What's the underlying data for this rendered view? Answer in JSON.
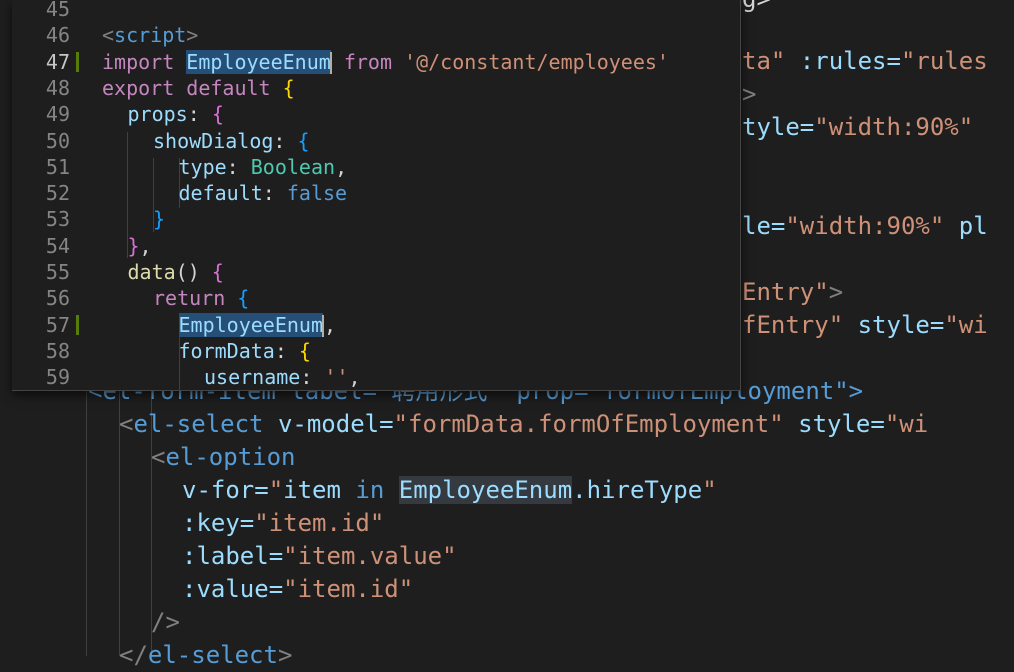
{
  "background_code": [
    {
      "segs": [
        {
          "t": "g>",
          "c": "#d4d4d4"
        }
      ]
    },
    {
      "segs": [
        {
          "t": "ta\"",
          "c": "#ce9178"
        },
        {
          "t": " :rules=",
          "c": "#9cdcfe"
        },
        {
          "t": "\"rules",
          "c": "#ce9178"
        }
      ]
    },
    {
      "segs": [
        {
          "t": ">",
          "c": "#808080"
        }
      ]
    },
    {
      "segs": [
        {
          "t": "tyle=",
          "c": "#9cdcfe"
        },
        {
          "t": "\"width:90%\"",
          "c": "#ce9178"
        }
      ]
    },
    {
      "segs": []
    },
    {
      "segs": [
        {
          "t": "le=",
          "c": "#9cdcfe"
        },
        {
          "t": "\"width:90%\"",
          "c": "#ce9178"
        },
        {
          "t": " pl",
          "c": "#9cdcfe"
        }
      ]
    },
    {
      "segs": []
    },
    {
      "segs": [
        {
          "t": "Entry\"",
          "c": "#ce9178"
        },
        {
          "t": ">",
          "c": "#808080"
        }
      ]
    },
    {
      "segs": [
        {
          "t": "fEntry\"",
          "c": "#ce9178"
        },
        {
          "t": " style=",
          "c": "#9cdcfe"
        },
        {
          "t": "\"wi",
          "c": "#ce9178"
        }
      ]
    },
    {
      "segs": [
        {
          "t": "<el-form-item label=\"聘用形式\" prop=\"formOfEmployment\">",
          "c": "#569cd6"
        }
      ]
    },
    {
      "segs": [
        {
          "t": "<",
          "c": "#808080"
        },
        {
          "t": "el-select",
          "c": "#569cd6"
        },
        {
          "t": " v-model=",
          "c": "#9cdcfe"
        },
        {
          "t": "\"formData.formOfEmployment\"",
          "c": "#ce9178"
        },
        {
          "t": " style=",
          "c": "#9cdcfe"
        },
        {
          "t": "\"wi",
          "c": "#ce9178"
        }
      ]
    },
    {
      "segs": [
        {
          "t": "<",
          "c": "#808080"
        },
        {
          "t": "el-option",
          "c": "#569cd6"
        }
      ]
    },
    {
      "segs": [
        {
          "t": "v-for=",
          "c": "#9cdcfe"
        },
        {
          "t": "\"",
          "c": "#ce9178"
        },
        {
          "t": "item",
          "c": "#9cdcfe"
        },
        {
          "t": " in ",
          "c": "#569cd6"
        },
        {
          "t": "EmployeeEnum",
          "c": "#9cdcfe",
          "hl": true
        },
        {
          "t": ".hireType",
          "c": "#9cdcfe"
        },
        {
          "t": "\"",
          "c": "#ce9178"
        }
      ]
    },
    {
      "segs": [
        {
          "t": ":key=",
          "c": "#9cdcfe"
        },
        {
          "t": "\"item.id\"",
          "c": "#ce9178"
        }
      ]
    },
    {
      "segs": [
        {
          "t": ":label=",
          "c": "#9cdcfe"
        },
        {
          "t": "\"item.value\"",
          "c": "#ce9178"
        }
      ]
    },
    {
      "segs": [
        {
          "t": ":value=",
          "c": "#9cdcfe"
        },
        {
          "t": "\"item.id\"",
          "c": "#ce9178"
        }
      ]
    },
    {
      "segs": [
        {
          "t": "/>",
          "c": "#808080"
        }
      ]
    },
    {
      "segs": [
        {
          "t": "</",
          "c": "#808080"
        },
        {
          "t": "el-select",
          "c": "#569cd6"
        },
        {
          "t": ">",
          "c": "#808080"
        }
      ]
    }
  ],
  "peek": {
    "line_numbers": [
      "45",
      "46",
      "47",
      "48",
      "49",
      "50",
      "51",
      "52",
      "53",
      "54",
      "55",
      "56",
      "57",
      "58",
      "59"
    ],
    "active_line": "47",
    "modified_lines": [
      "47",
      "57"
    ],
    "lines": [
      {
        "segs": []
      },
      {
        "segs": [
          {
            "t": "<",
            "c": "tagp"
          },
          {
            "t": "script",
            "c": "tag"
          },
          {
            "t": ">",
            "c": "tagp"
          }
        ]
      },
      {
        "segs": [
          {
            "t": "import ",
            "c": "kw"
          },
          {
            "t": "EmployeeEnum",
            "c": "var",
            "hl": true,
            "caret": true
          },
          {
            "t": " from ",
            "c": "kw"
          },
          {
            "t": "'@/constant/employees'",
            "c": "str"
          }
        ]
      },
      {
        "segs": [
          {
            "t": "export ",
            "c": "kw"
          },
          {
            "t": "default ",
            "c": "kw"
          },
          {
            "t": "{",
            "c": "br1"
          }
        ]
      },
      {
        "segs": [
          {
            "t": "props",
            "c": "var"
          },
          {
            "t": ": ",
            "c": "plain"
          },
          {
            "t": "{",
            "c": "br2"
          }
        ]
      },
      {
        "segs": [
          {
            "t": "showDialog",
            "c": "var"
          },
          {
            "t": ": ",
            "c": "plain"
          },
          {
            "t": "{",
            "c": "br3"
          }
        ]
      },
      {
        "segs": [
          {
            "t": "type",
            "c": "var"
          },
          {
            "t": ": ",
            "c": "plain"
          },
          {
            "t": "Boolean",
            "c": "ty"
          },
          {
            "t": ",",
            "c": "plain"
          }
        ]
      },
      {
        "segs": [
          {
            "t": "default",
            "c": "var"
          },
          {
            "t": ": ",
            "c": "plain"
          },
          {
            "t": "false",
            "c": "kb"
          }
        ]
      },
      {
        "segs": [
          {
            "t": "}",
            "c": "br3"
          }
        ]
      },
      {
        "segs": [
          {
            "t": "}",
            "c": "br2"
          },
          {
            "t": ",",
            "c": "plain"
          }
        ]
      },
      {
        "segs": [
          {
            "t": "data",
            "c": "fn"
          },
          {
            "t": "() ",
            "c": "plain"
          },
          {
            "t": "{",
            "c": "br2"
          }
        ]
      },
      {
        "segs": [
          {
            "t": "return ",
            "c": "kw"
          },
          {
            "t": "{",
            "c": "br3"
          }
        ]
      },
      {
        "segs": [
          {
            "t": "EmployeeEnum",
            "c": "var",
            "hl": true,
            "caret": true
          },
          {
            "t": ",",
            "c": "plain"
          }
        ]
      },
      {
        "segs": [
          {
            "t": "formData",
            "c": "var"
          },
          {
            "t": ": ",
            "c": "plain"
          },
          {
            "t": "{",
            "c": "br1"
          }
        ]
      },
      {
        "segs": [
          {
            "t": "username",
            "c": "var"
          },
          {
            "t": ": ",
            "c": "plain"
          },
          {
            "t": "''",
            "c": "str"
          },
          {
            "t": ",",
            "c": "plain"
          }
        ]
      }
    ]
  }
}
